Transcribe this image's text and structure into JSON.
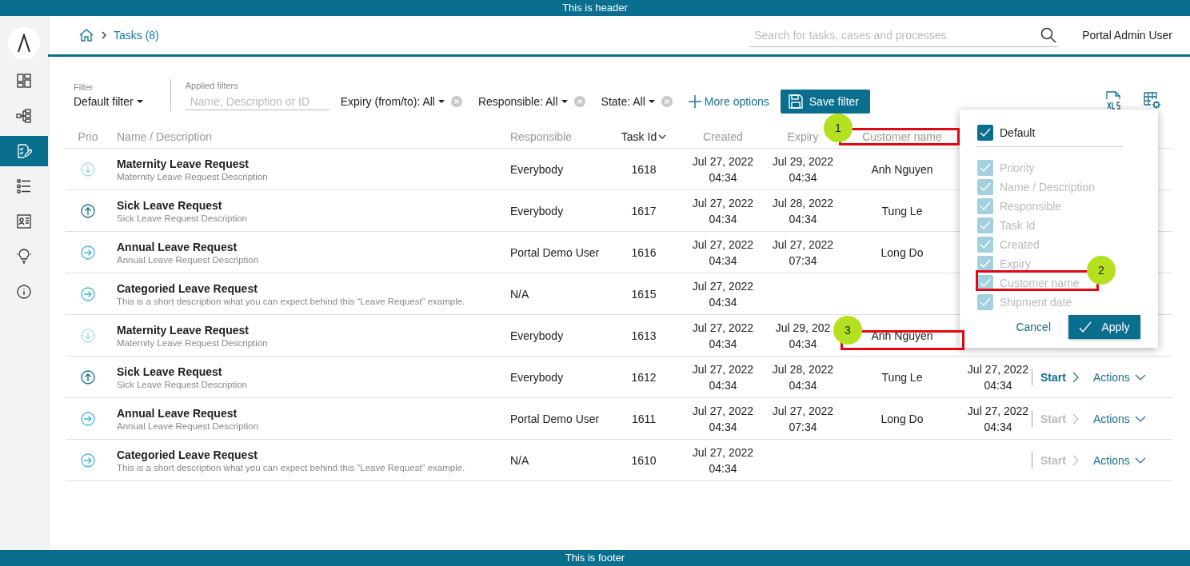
{
  "header": "This is header",
  "footer": "This is footer",
  "sidebar": {
    "items": [
      {
        "kind": "dashboard",
        "selected": false
      },
      {
        "kind": "process",
        "selected": false
      },
      {
        "kind": "task",
        "selected": true
      },
      {
        "kind": "list",
        "selected": false
      },
      {
        "kind": "card",
        "selected": false
      },
      {
        "kind": "bulb",
        "selected": false
      },
      {
        "kind": "info",
        "selected": false
      }
    ]
  },
  "breadcrumb": {
    "current": "Tasks (8)"
  },
  "search": {
    "placeholder": "Search for tasks, cases and processes"
  },
  "user": "Portal Admin User",
  "filter": {
    "label": "Filter",
    "value": "Default filter",
    "applied_label": "Applied filters",
    "placeholder": "Name, Description or ID",
    "chips": [
      "Expiry (from/to): All",
      "Responsible: All",
      "State: All"
    ],
    "more": "More options",
    "save": "Save filter"
  },
  "table": {
    "columns": [
      {
        "label": "Prio",
        "sorted": false
      },
      {
        "label": "Name / Description",
        "sorted": false
      },
      {
        "label": "Responsible",
        "sorted": false
      },
      {
        "label": "Task Id",
        "sorted": true
      },
      {
        "label": "Created",
        "sorted": false
      },
      {
        "label": "Expiry",
        "sorted": false
      },
      {
        "label": "Customer name",
        "sorted": false
      }
    ],
    "rows": [
      {
        "kind": "low",
        "name": "Maternity Leave Request",
        "description": "Maternity Leave Request Description",
        "responsible": "Everybody",
        "task_id": "1618",
        "created": "Jul 27, 2022\n04:34",
        "expiry": "Jul 29, 2022\n04:34",
        "customer": "Anh Nguyen"
      },
      {
        "kind": "high",
        "name": "Sick Leave Request",
        "description": "Sick Leave Request Description",
        "responsible": "Everybody",
        "task_id": "1617",
        "created": "Jul 27, 2022\n04:34",
        "expiry": "Jul 28, 2022\n04:34",
        "customer": "Tung Le"
      },
      {
        "kind": "normal",
        "name": "Annual Leave Request",
        "description": "Annual Leave Request Description",
        "responsible": "Portal Demo User",
        "task_id": "1616",
        "created": "Jul 27, 2022\n04:34",
        "expiry": "Jul 27, 2022\n07:34",
        "customer": "Long Do"
      },
      {
        "kind": "normal",
        "name": "Categoried Leave Request",
        "description": "This is a short description what you can expect behind this “Leave Request” example.",
        "responsible": "N/A",
        "task_id": "1615",
        "created": "Jul 27, 2022\n04:34"
      },
      {
        "kind": "low",
        "name": "Maternity Leave Request",
        "description": "Maternity Leave Request Description",
        "responsible": "Everybody",
        "task_id": "1613",
        "created": "Jul 27, 2022\n04:34",
        "expiry": "Jul 29, 202\n04:34",
        "customer": "Anh Nguyen"
      },
      {
        "kind": "high",
        "name": "Sick Leave Request",
        "description": "Sick Leave Request Description",
        "responsible": "Everybody",
        "task_id": "1612",
        "created": "Jul 27, 2022\n04:34",
        "expiry": "Jul 28, 2022\n04:34",
        "customer": "Tung Le",
        "shipment": "Jul 27, 2022\n04:34",
        "start": {
          "label": "Start",
          "disabled": false
        },
        "actions": "Actions"
      },
      {
        "kind": "normal",
        "name": "Annual Leave Request",
        "description": "Annual Leave Request Description",
        "responsible": "Portal Demo User",
        "task_id": "1611",
        "created": "Jul 27, 2022\n04:34",
        "expiry": "Jul 27, 2022\n07:34",
        "customer": "Long Do",
        "shipment": "Jul 27, 2022\n04:34",
        "start": {
          "label": "Start",
          "disabled": true
        },
        "actions": "Actions"
      },
      {
        "kind": "normal",
        "name": "Categoried Leave Request",
        "description": "This is a short description what you can expect behind this “Leave Request” example.",
        "responsible": "N/A",
        "task_id": "1610",
        "created": "Jul 27, 2022\n04:34",
        "start": {
          "label": "Start",
          "disabled": true
        },
        "actions": "Actions"
      }
    ]
  },
  "column_popup": {
    "default": {
      "label": "Default",
      "checked": true
    },
    "items": [
      {
        "label": "Priority",
        "checked": true,
        "disabled": true
      },
      {
        "label": "Name / Description",
        "checked": true,
        "disabled": true
      },
      {
        "label": "Responsible",
        "checked": true,
        "disabled": true
      },
      {
        "label": "Task Id",
        "checked": true,
        "disabled": true
      },
      {
        "label": "Created",
        "checked": true,
        "disabled": true
      },
      {
        "label": "Expiry",
        "checked": true,
        "disabled": true
      },
      {
        "label": "Customer name",
        "checked": true,
        "disabled": true
      },
      {
        "label": "Shipment date",
        "checked": true,
        "disabled": true
      }
    ],
    "cancel": "Cancel",
    "apply": "Apply"
  },
  "annotations": [
    {
      "label": "1"
    },
    {
      "label": "2"
    },
    {
      "label": "3"
    }
  ]
}
